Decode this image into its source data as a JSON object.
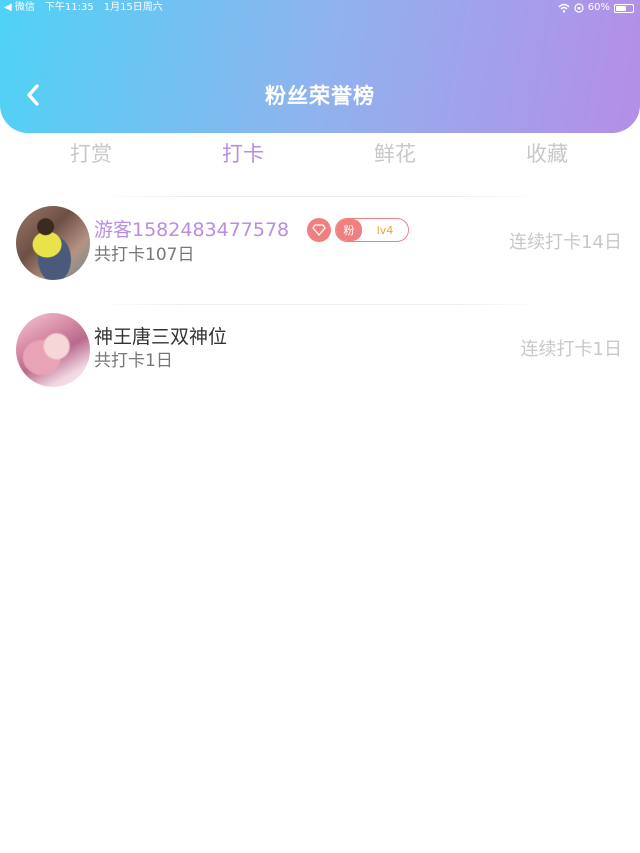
{
  "statusbar": {
    "left_app": "◀ 微信",
    "time": "下午11:35",
    "date": "1月15日周六",
    "battery": "60%",
    "battery_level": 0.6
  },
  "header": {
    "title": "粉丝荣誉榜",
    "gradient_colors": [
      "#4fd2f6",
      "#8fb3ee",
      "#b58ee8"
    ]
  },
  "tabs": [
    {
      "label": "打赏",
      "active": false
    },
    {
      "label": "打卡",
      "active": true
    },
    {
      "label": "鲜花",
      "active": false
    },
    {
      "label": "收藏",
      "active": false
    }
  ],
  "colors": {
    "accent": "#b98ee0",
    "badge": "#f08080",
    "level": "#e6a53c",
    "inactive_text": "#c8c8c8"
  },
  "list": [
    {
      "name": "游客1582483477578",
      "total": "共打卡107日",
      "streak": "连续打卡14日",
      "badge_fan": "粉",
      "badge_level": "lv4",
      "highlight": true
    },
    {
      "name": "神王唐三双神位",
      "total": "共打卡1日",
      "streak": "连续打卡1日",
      "highlight": false
    }
  ]
}
